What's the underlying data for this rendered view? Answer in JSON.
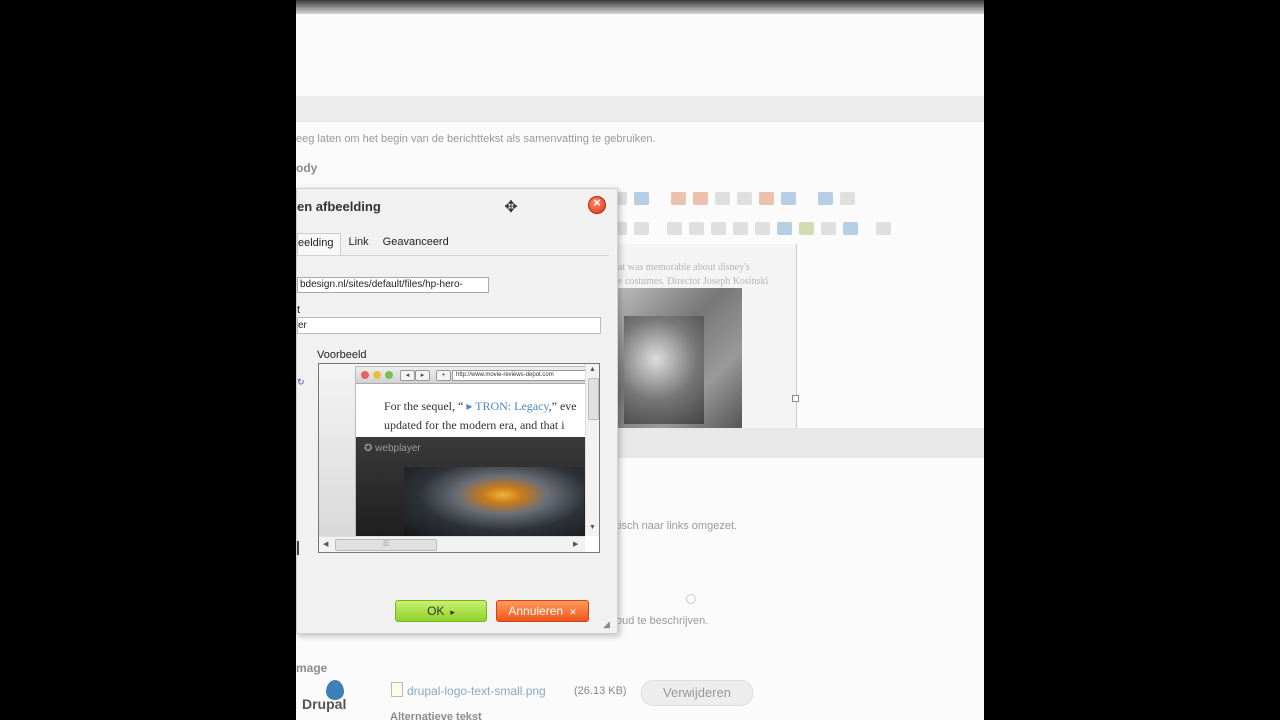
{
  "page": {
    "summary_hint": "eeg laten om het begin van de berichttekst als samenvatting te gebruiken.",
    "body_label": "ody",
    "links_hint": "tisch naar links omgezet.",
    "describe_hint": "oud te beschrijven.",
    "image_label": "mage",
    "alt_text_label": "Alternatieve tekst",
    "file": {
      "name": "drupal-logo-text-small.png",
      "size": "(26.13 KB)",
      "remove_label": "Verwijderen",
      "logo_text": "Drupal"
    },
    "editor_preview_lines": [
      "at was memorable about disney's",
      "e costumes. Director Joseph Kosinski"
    ]
  },
  "dialog": {
    "title": "en afbeelding",
    "tabs": [
      "eelding",
      "Link",
      "Geavanceerd"
    ],
    "url_value": "bdesign.nl/sites/default/files/hp-hero-",
    "alt_label": "t",
    "alt_value": "er",
    "preview_label": "Voorbeeld",
    "preview": {
      "browser_url": "http://www.movie-reviews-depot.com",
      "line1_pre": "For the sequel, “ ",
      "line1_link": "▸ TRON: Legacy",
      "line1_post": ",” eve",
      "line2": "updated for the modern era, and that i",
      "webplayer": "webplayer"
    },
    "ok_label": "OK",
    "cancel_label": "Annuleren"
  },
  "colors": {
    "ok": "#9ad634",
    "cancel": "#f0561c",
    "close": "#d8361a",
    "link": "#4a88c8"
  }
}
